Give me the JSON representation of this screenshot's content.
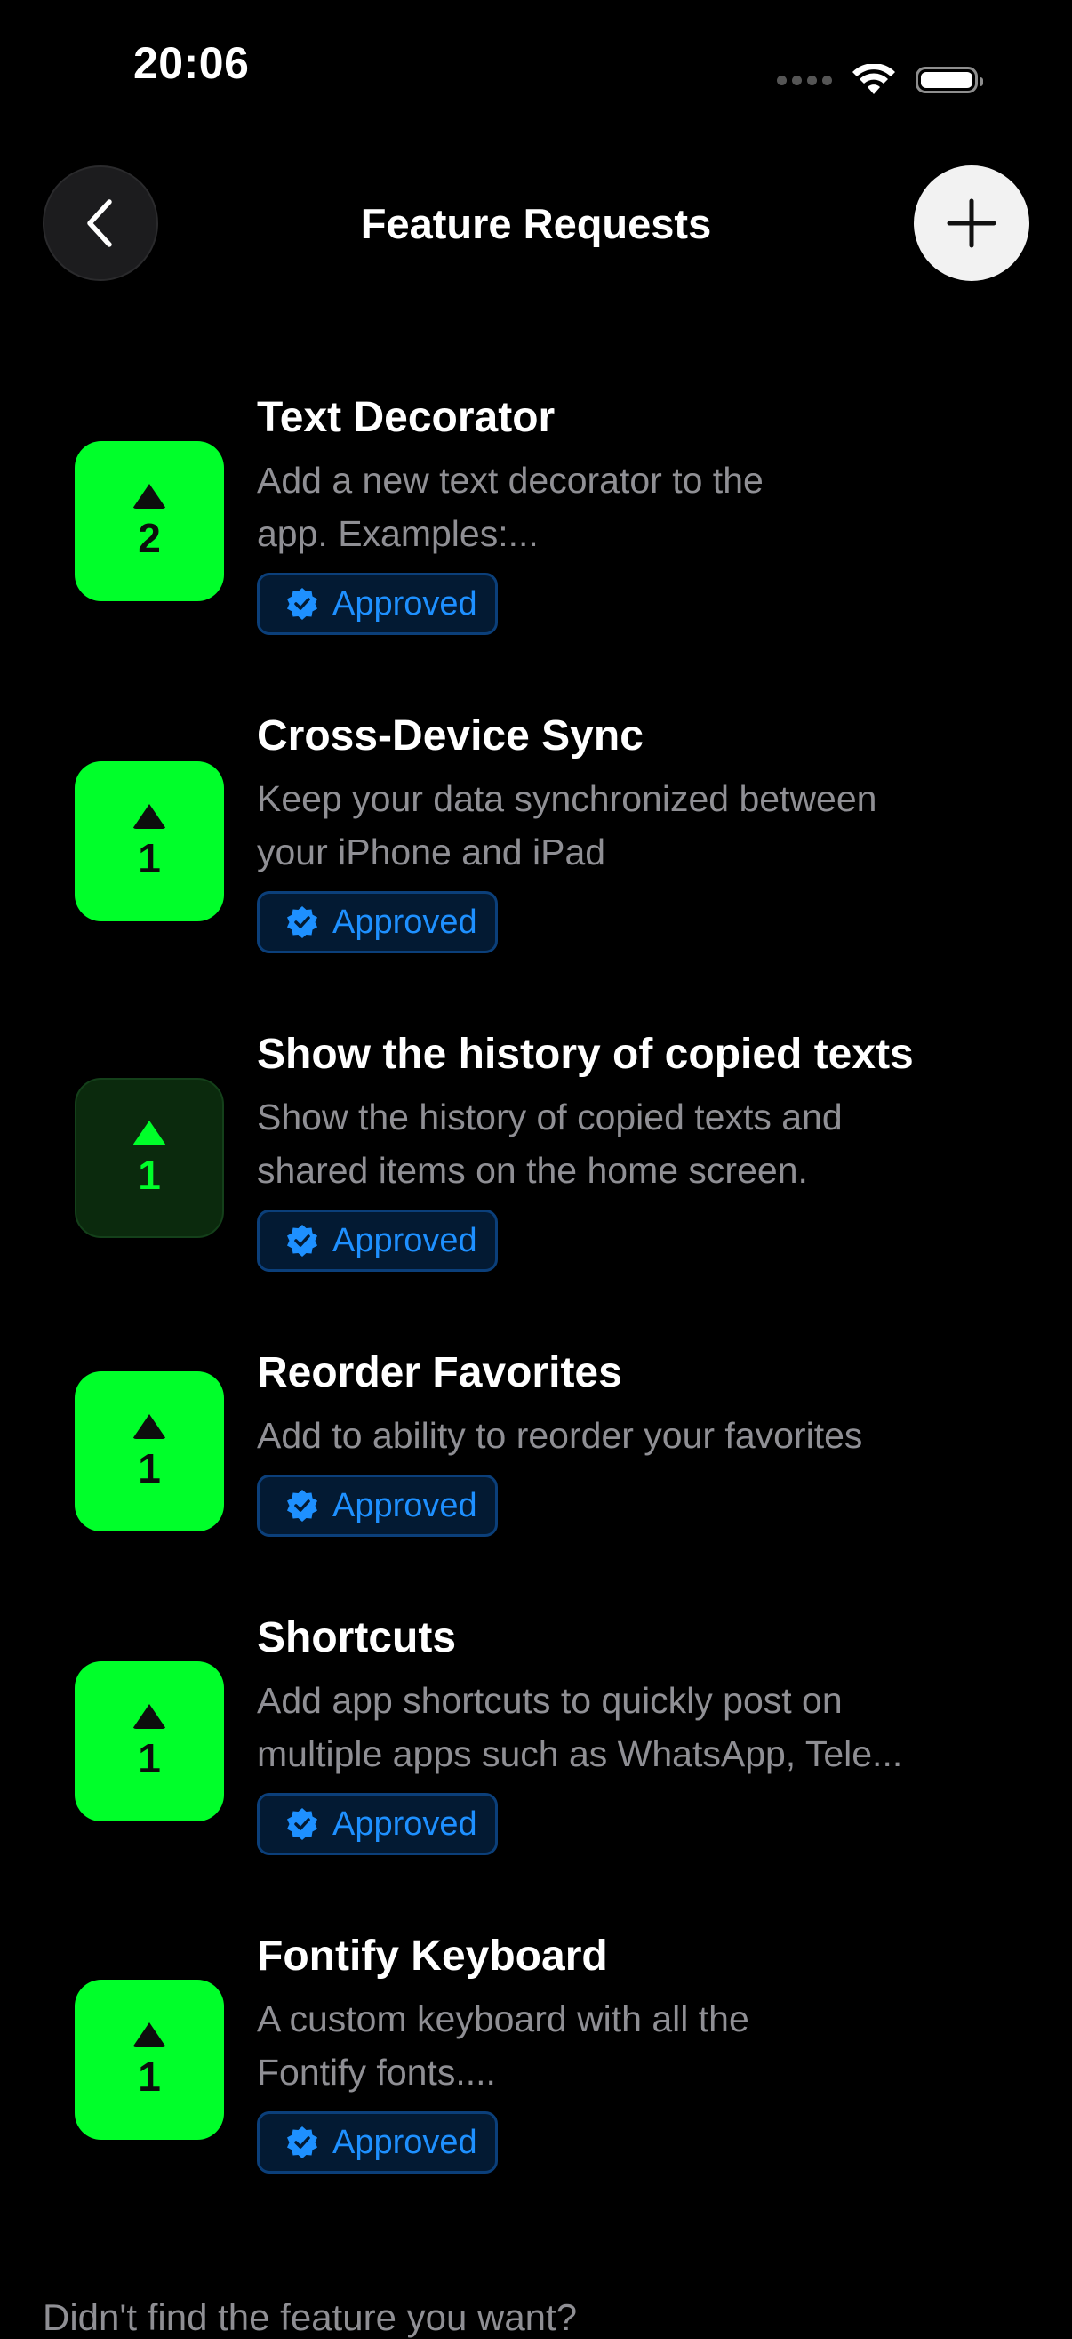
{
  "status_bar": {
    "time": "20:06"
  },
  "nav": {
    "title": "Feature Requests"
  },
  "features": [
    {
      "title": "Text Decorator",
      "description": "Add a new text decorator to the\napp. Examples:...",
      "votes": "2",
      "status": "Approved",
      "vote_style": "filled"
    },
    {
      "title": "Cross-Device Sync",
      "description": "Keep your data synchronized between\nyour iPhone and iPad",
      "votes": "1",
      "status": "Approved",
      "vote_style": "filled"
    },
    {
      "title": "Show the history of copied texts",
      "description": "Show the history of copied texts and\nshared items on the home screen.",
      "votes": "1",
      "status": "Approved",
      "vote_style": "voted"
    },
    {
      "title": "Reorder Favorites",
      "description": "Add to ability to reorder your favorites",
      "votes": "1",
      "status": "Approved",
      "vote_style": "filled"
    },
    {
      "title": "Shortcuts",
      "description": "Add app shortcuts to quickly post on\nmultiple apps such as WhatsApp, Tele...",
      "votes": "1",
      "status": "Approved",
      "vote_style": "filled"
    },
    {
      "title": "Fontify Keyboard",
      "description": "A custom keyboard with all the\nFontify fonts....",
      "votes": "1",
      "status": "Approved",
      "vote_style": "filled"
    }
  ],
  "footer": {
    "prompt": "Didn't find the feature you want?"
  },
  "colors": {
    "vote_green": "#00ff2a",
    "badge_blue": "#1e90ff",
    "background": "#000000"
  }
}
